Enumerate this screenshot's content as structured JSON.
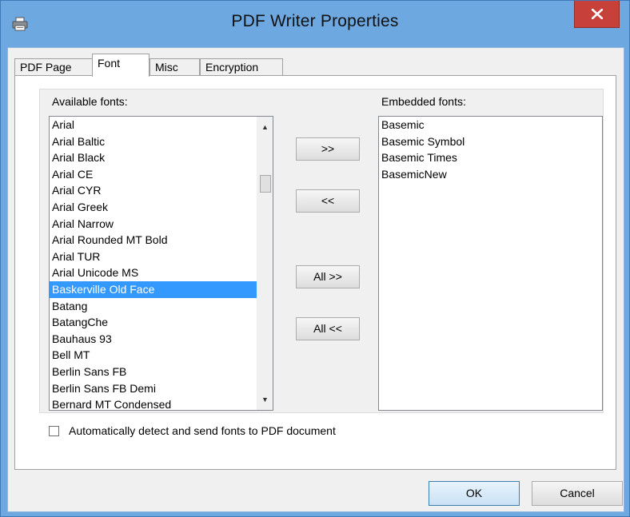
{
  "window": {
    "title": "PDF Writer Properties"
  },
  "tabs": [
    {
      "label": "PDF Page",
      "active": false
    },
    {
      "label": "Font",
      "active": true
    },
    {
      "label": "Misc",
      "active": false
    },
    {
      "label": "Encryption",
      "active": false
    }
  ],
  "available": {
    "label": "Available fonts:",
    "selected": "Baskerville Old Face",
    "items": [
      "Arial",
      "Arial Baltic",
      "Arial Black",
      "Arial CE",
      "Arial CYR",
      "Arial Greek",
      "Arial Narrow",
      "Arial Rounded MT Bold",
      "Arial TUR",
      "Arial Unicode MS",
      "Baskerville Old Face",
      "Batang",
      "BatangChe",
      "Bauhaus 93",
      "Bell MT",
      "Berlin Sans FB",
      "Berlin Sans FB Demi",
      "Bernard MT Condensed"
    ]
  },
  "embedded": {
    "label": "Embedded fonts:",
    "items": [
      "Basemic",
      "Basemic Symbol",
      "Basemic Times",
      "BasemicNew"
    ]
  },
  "buttons": {
    "add": ">>",
    "remove": "<<",
    "add_all": "All >>",
    "remove_all": "All <<",
    "ok": "OK",
    "cancel": "Cancel"
  },
  "auto_detect": {
    "label": "Automatically detect and send fonts to PDF document",
    "checked": false
  },
  "colors": {
    "titlebar": "#6ea8e0",
    "close": "#c7413a",
    "selection": "#3399ff"
  }
}
